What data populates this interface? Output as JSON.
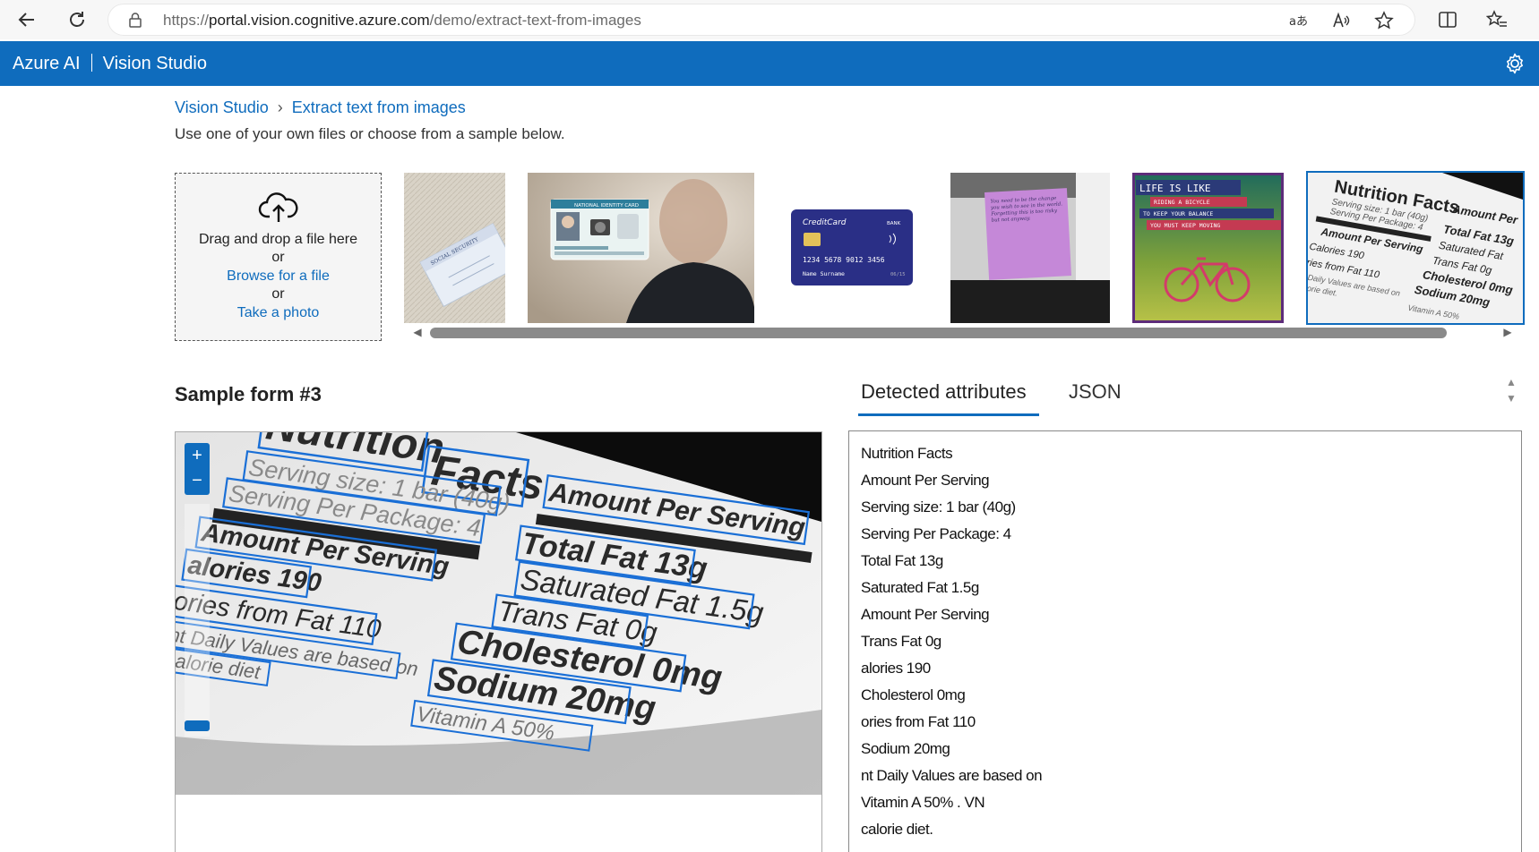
{
  "browser": {
    "url_prefix": "https://",
    "url_host": "portal.vision.cognitive.azure.com",
    "url_path": "/demo/extract-text-from-images",
    "icons": [
      "back-icon",
      "refresh-icon",
      "lock-icon",
      "translate-icon",
      "read-aloud-icon",
      "favorite-star-icon",
      "split-screen-icon",
      "favorites-icon"
    ]
  },
  "app": {
    "brand_left": "Azure AI",
    "brand_right": "Vision Studio",
    "accent_color": "#0f6cbd"
  },
  "breadcrumb": {
    "root": "Vision Studio",
    "current": "Extract text from images"
  },
  "subtitle": "Use one of your own files or choose from a sample below.",
  "dropzone": {
    "line1": "Drag and drop a file here",
    "or1": "or",
    "browse": "Browse for a file",
    "or2": "or",
    "photo": "Take a photo"
  },
  "samples": {
    "card_brand": "CreditCard",
    "card_bank": "BANK",
    "card_number": "1234 5678 9012 3456",
    "card_name": "Name Surname",
    "card_expiry": "06/15",
    "id_card_title": "NATIONAL IDENTITY CARD",
    "ssn_card_title": "SOCIAL SECURITY",
    "poster_line1": "LIFE IS LIKE",
    "poster_line2": "RIDING A BICYCLE",
    "poster_line3": "TO KEEP YOUR BALANCE",
    "poster_line4": "YOU MUST KEEP MOVING",
    "note_text": "You need to be the change you wish to see in the world. Forgetting this is too risky but not anyway.",
    "nutrition_title": "Nutrition Facts",
    "nutrition_amount": "Amount Per",
    "nutrition_serving": "Serving size: 1 bar (40g)",
    "nutrition_package": "Serving Per Package: 4",
    "nutrition_aps": "Amount Per Serving",
    "nutrition_fat": "Total Fat 13g",
    "nutrition_satfat": "Saturated Fat",
    "nutrition_trans": "Trans Fat 0g",
    "nutrition_cal": "Calories 190",
    "nutrition_chol": "Cholesterol 0mg",
    "nutrition_calfat": "ories from Fat 110",
    "nutrition_sodium": "Sodium 20mg",
    "nutrition_dv": "nt Daily Values are based on",
    "nutrition_diet": "calorie diet.",
    "nutrition_vit": "Vitamin A 50%"
  },
  "form_title": "Sample form #3",
  "tabs": {
    "active": "Detected attributes",
    "inactive": "JSON"
  },
  "zoom": {
    "plus": "+",
    "minus": "−",
    "level": 0.1
  },
  "image_words": {
    "w1": "Nutrition",
    "w2": "Facts",
    "w3": "Serving size: 1 bar (40g)",
    "w4": "Serving Per Package: 4",
    "w5": "Amount Per Serving",
    "w6": "Amount Per Serving",
    "w7": "Total Fat 13g",
    "w8": "alories 190",
    "w9": "Saturated Fat 1.5g",
    "w10": "ories from Fat 110",
    "w11": "Trans Fat 0g",
    "w12": "Cholesterol 0mg",
    "w13": "nt Daily Values are based on",
    "w14": "calorie diet",
    "w15": "Sodium 20mg",
    "w16": "Vitamin A 50%"
  },
  "detected_attributes": [
    "Nutrition Facts",
    "Amount Per Serving",
    "Serving size: 1 bar (40g)",
    "Serving Per Package: 4",
    "Total Fat 13g",
    "Saturated Fat 1.5g",
    "Amount Per Serving",
    "Trans Fat 0g",
    "alories 190",
    "Cholesterol 0mg",
    "ories from Fat 110",
    "Sodium 20mg",
    "nt Daily Values are based on",
    "Vitamin A 50% . VN",
    "calorie diet."
  ]
}
